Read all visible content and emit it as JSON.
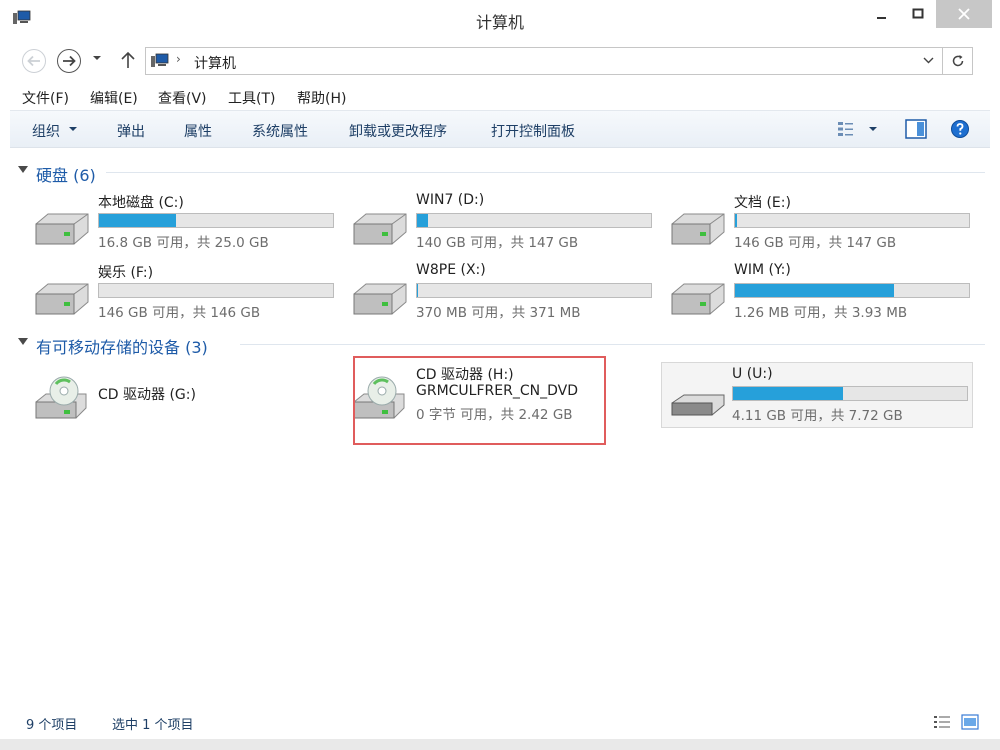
{
  "window": {
    "title": "计算机"
  },
  "address": {
    "path": "计算机",
    "separator": "›"
  },
  "menu": {
    "items": [
      "文件(F)",
      "编辑(E)",
      "查看(V)",
      "工具(T)",
      "帮助(H)"
    ]
  },
  "commands": {
    "organize": "组织",
    "eject": "弹出",
    "properties": "属性",
    "system_properties": "系统属性",
    "uninstall": "卸载或更改程序",
    "control_panel": "打开控制面板"
  },
  "groups": {
    "hard_disks": "硬盘 (6)",
    "removable": "有可移动存储的设备 (3)"
  },
  "drives": [
    {
      "name": "本地磁盘 (C:)",
      "info": "16.8 GB 可用，共 25.0 GB",
      "used_fraction": 0.328
    },
    {
      "name": "WIN7 (D:)",
      "info": "140 GB 可用，共 147 GB",
      "used_fraction": 0.048
    },
    {
      "name": "文档 (E:)",
      "info": "146 GB 可用，共 147 GB",
      "used_fraction": 0.007
    },
    {
      "name": "娱乐 (F:)",
      "info": "146 GB 可用，共 146 GB",
      "used_fraction": 0.0
    },
    {
      "name": "W8PE (X:)",
      "info": "370 MB 可用，共 371 MB",
      "used_fraction": 0.003
    },
    {
      "name": "WIM (Y:)",
      "info": "1.26 MB 可用，共 3.93 MB",
      "used_fraction": 0.679
    }
  ],
  "removable_drives": [
    {
      "name": "CD 驱动器 (G:)"
    },
    {
      "name": "CD 驱动器 (H:)",
      "label": "GRMCULFRER_CN_DVD",
      "info": "0 字节 可用，共 2.42 GB"
    },
    {
      "name": "U (U:)",
      "info": "4.11 GB 可用，共 7.72 GB",
      "used_fraction": 0.468
    }
  ],
  "status": {
    "item_count": "9 个项目",
    "selected": "选中 1 个项目"
  },
  "colors": {
    "accent": "#26a0da",
    "link_text": "#1e3f66",
    "group_title": "#1e5ba8",
    "highlight": "#e05c5c"
  },
  "icons": {
    "app": "computer-icon",
    "refresh": "refresh-icon",
    "help": "help-icon"
  }
}
